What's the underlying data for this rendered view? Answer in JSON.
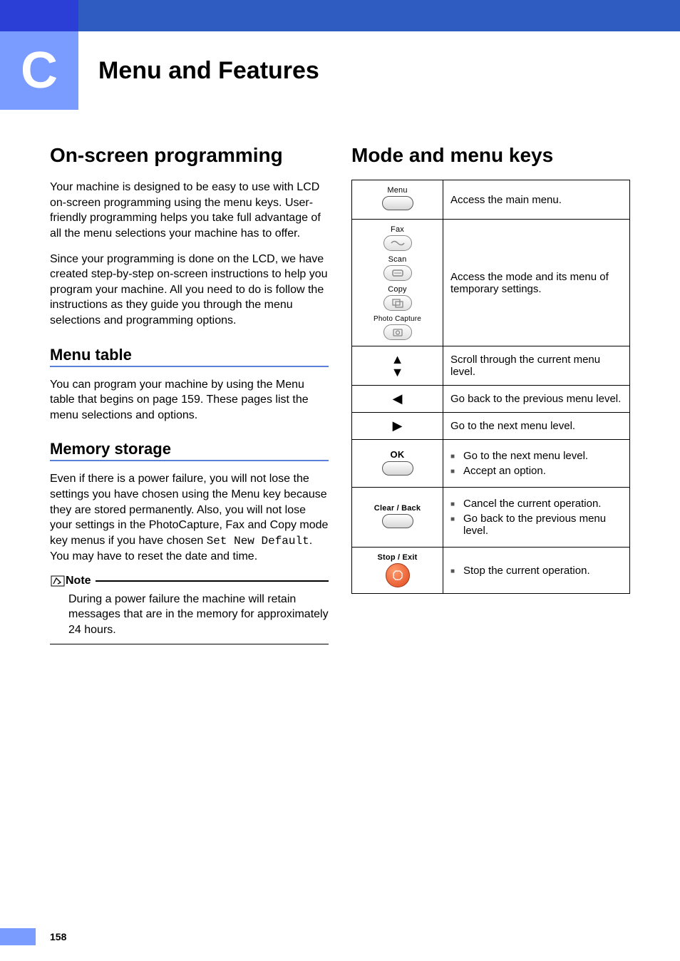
{
  "chapter": {
    "letter": "C",
    "title": "Menu and Features"
  },
  "left": {
    "h1": "On-screen programming",
    "p1": "Your machine is designed to be easy to use with LCD on-screen programming using the menu keys. User-friendly programming helps you take full advantage of all the menu selections your machine has to offer.",
    "p2": "Since your programming is done on the LCD, we have created step-by-step on-screen instructions to help you program your machine. All you need to do is follow the instructions as they guide you through the menu selections and programming options.",
    "sub1": "Menu table",
    "p3": "You can program your machine by using the Menu table that begins on page 159. These pages list the menu selections and options.",
    "sub2": "Memory storage",
    "p4_a": "Even if there is a power failure, you will not lose the settings you have chosen using the Menu key because they are stored permanently. Also, you will not lose your settings in the PhotoCapture, Fax and Copy mode key menus if you have chosen ",
    "p4_mono": "Set New Default",
    "p4_b": ". You may have to reset the date and time.",
    "note_label": "Note",
    "note_body": "During a power failure the machine will retain messages that are in the memory for approximately 24 hours."
  },
  "right": {
    "h1": "Mode and menu keys",
    "rows": {
      "menu": {
        "label": "Menu",
        "desc": "Access the main menu."
      },
      "modes": {
        "labels": {
          "fax": "Fax",
          "scan": "Scan",
          "copy": "Copy",
          "photo": "Photo Capture"
        },
        "desc": "Access the mode and its menu of temporary settings."
      },
      "updown": {
        "desc": "Scroll through the current menu level."
      },
      "left": {
        "desc": "Go back to the previous menu level."
      },
      "rightarrow": {
        "desc": "Go to the next menu level."
      },
      "ok": {
        "label": "OK",
        "items": [
          "Go to the next menu level.",
          "Accept an option."
        ]
      },
      "clear": {
        "label": "Clear / Back",
        "items": [
          "Cancel the current operation.",
          "Go back to the previous menu level."
        ]
      },
      "stop": {
        "label": "Stop / Exit",
        "items": [
          "Stop the current operation."
        ]
      }
    }
  },
  "page_number": "158"
}
